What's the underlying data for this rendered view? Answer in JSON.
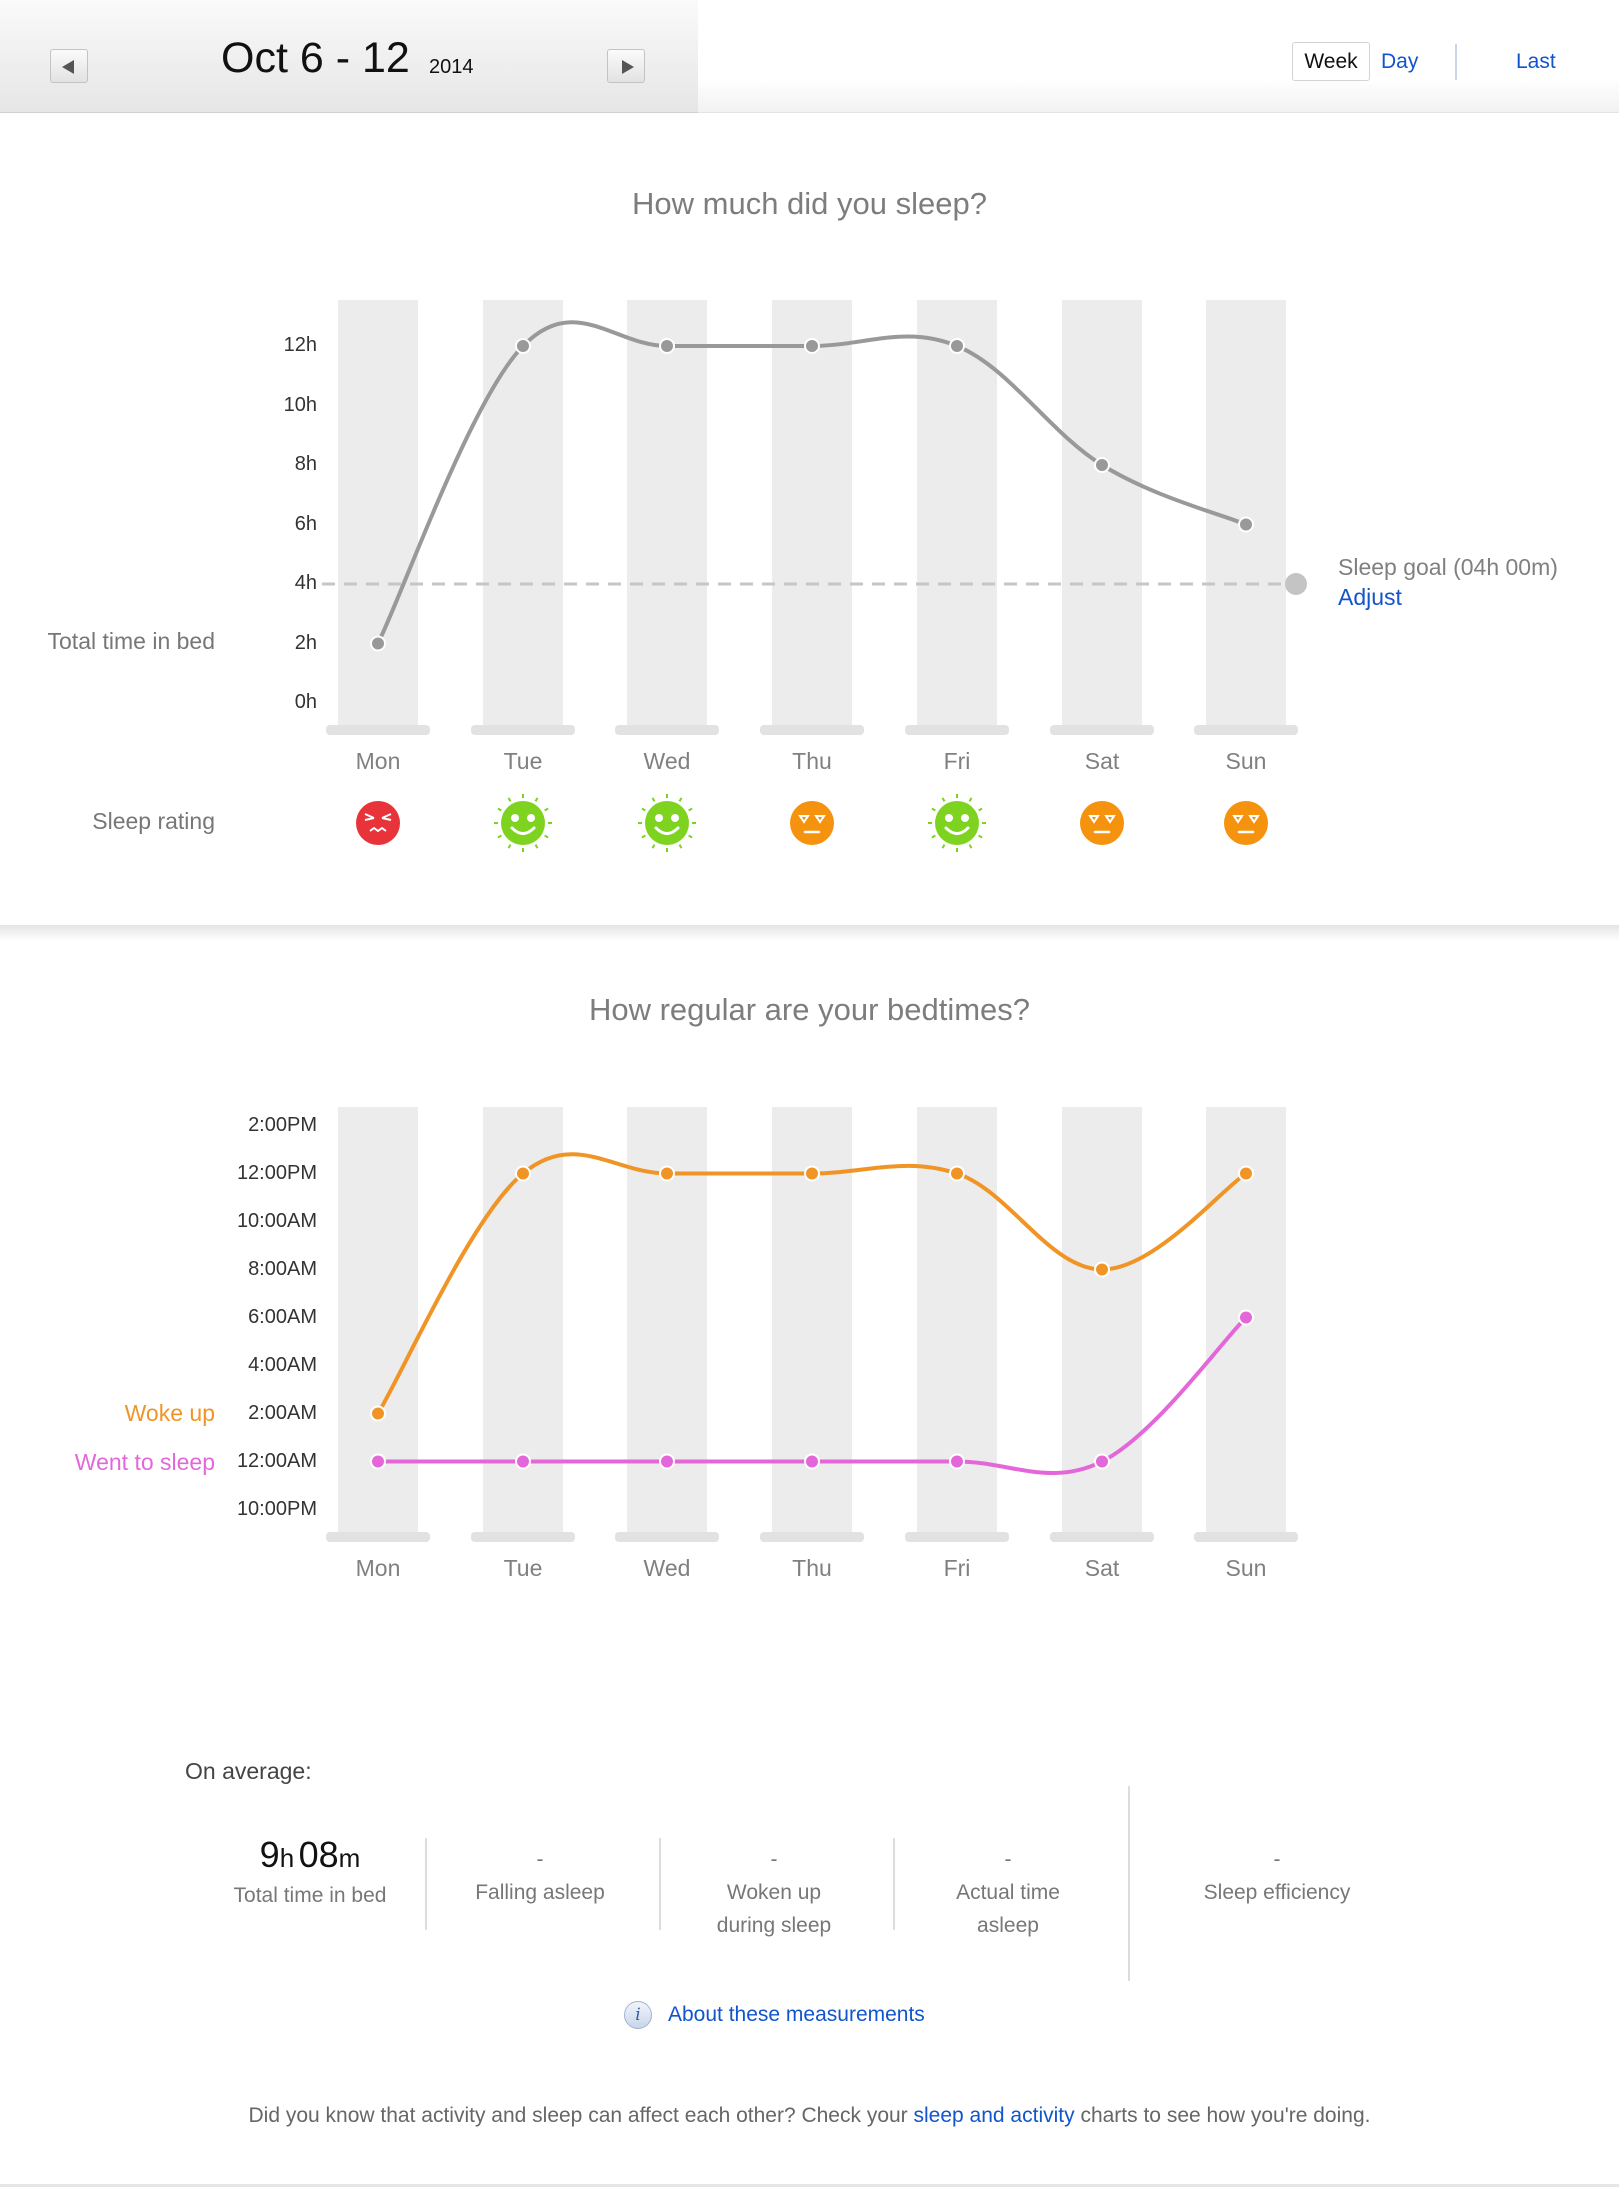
{
  "header": {
    "date_range": "Oct 6 - 12",
    "year": "2014",
    "view_week": "Week",
    "view_day": "Day",
    "last": "Last"
  },
  "sleep_section": {
    "title": "How much did you sleep?",
    "row_label": "Total time in bed",
    "goal_label": "Sleep goal (04h 00m)",
    "adjust": "Adjust",
    "rating_label": "Sleep rating",
    "ratings": [
      "bad",
      "great",
      "great",
      "ok",
      "great",
      "ok",
      "ok"
    ],
    "colors": {
      "line": "#999999",
      "goal": "#c6c6c6",
      "bad": "#e8333a",
      "great": "#7ed321",
      "ok": "#f5920e"
    }
  },
  "bedtime_section": {
    "title": "How regular are your bedtimes?",
    "woke_label": "Woke up",
    "sleep_label": "Went to sleep",
    "colors": {
      "woke": "#f09525",
      "sleep": "#e467d9"
    }
  },
  "chart_data": [
    {
      "type": "line",
      "title": "How much did you sleep?",
      "categories": [
        "Mon",
        "Tue",
        "Wed",
        "Thu",
        "Fri",
        "Sat",
        "Sun"
      ],
      "y_ticks": [
        "12h",
        "10h",
        "8h",
        "6h",
        "4h",
        "2h",
        "0h"
      ],
      "ylim": [
        0,
        12
      ],
      "series": [
        {
          "name": "Total time in bed",
          "values": [
            2,
            12,
            12,
            12,
            12,
            8,
            6
          ]
        }
      ],
      "goal": 4
    },
    {
      "type": "line",
      "title": "How regular are your bedtimes?",
      "categories": [
        "Mon",
        "Tue",
        "Wed",
        "Thu",
        "Fri",
        "Sat",
        "Sun"
      ],
      "y_ticks": [
        "2:00PM",
        "12:00PM",
        "10:00AM",
        "8:00AM",
        "6:00AM",
        "4:00AM",
        "2:00AM",
        "12:00AM",
        "10:00PM"
      ],
      "ylim": [
        "10:00PM",
        "2:00PM"
      ],
      "series": [
        {
          "name": "Woke up",
          "values": [
            "2:00AM",
            "12:00PM",
            "12:00PM",
            "12:00PM",
            "12:00PM",
            "8:00AM",
            "12:00PM"
          ]
        },
        {
          "name": "Went to sleep",
          "values": [
            "12:00AM",
            "12:00AM",
            "12:00AM",
            "12:00AM",
            "12:00AM",
            "12:00AM",
            "6:00AM"
          ]
        }
      ]
    }
  ],
  "average": {
    "title": "On average:",
    "hours": "9",
    "h_unit": "h",
    "minutes": "08",
    "m_unit": "m",
    "total_label": "Total time in bed",
    "falling_value": "-",
    "falling_label": "Falling asleep",
    "woken_value": "-",
    "woken_label_1": "Woken up",
    "woken_label_2": "during sleep",
    "actual_value": "-",
    "actual_label_1": "Actual time",
    "actual_label_2": "asleep",
    "efficiency_value": "-",
    "efficiency_label": "Sleep efficiency",
    "about": "About these measurements",
    "info_glyph": "i"
  },
  "footer": {
    "before": "Did you know that activity and sleep can affect each other? Check your ",
    "link": "sleep and activity",
    "after": " charts to see how you're doing."
  }
}
